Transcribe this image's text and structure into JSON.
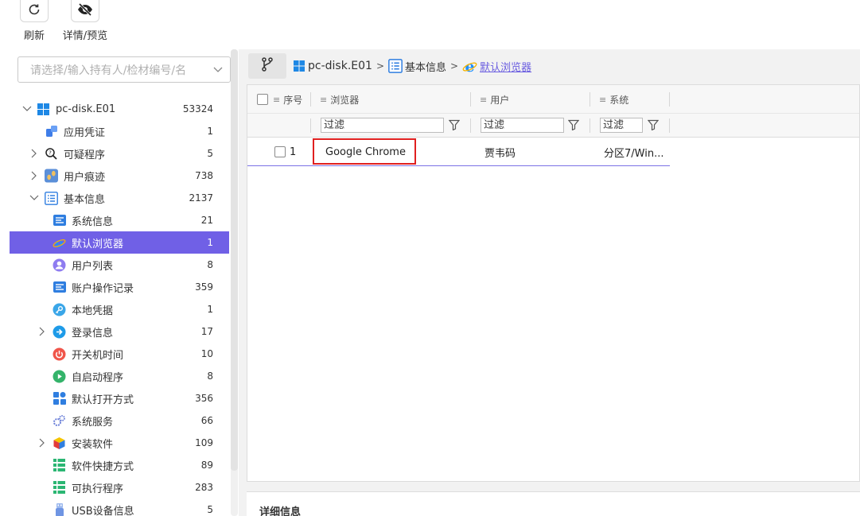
{
  "toolbar": {
    "refresh_label": "刷新",
    "detail_label": "详情/预览"
  },
  "search": {
    "placeholder": "请选择/输入持有人/检材编号/名"
  },
  "tree": {
    "root": {
      "label": "pc-disk.E01",
      "count": "53324",
      "icon": "windows-icon"
    },
    "items": [
      {
        "label": "应用凭证",
        "count": "1",
        "icon": "app-credential-icon"
      },
      {
        "label": "可疑程序",
        "count": "5",
        "icon": "suspicious-program-icon"
      },
      {
        "label": "用户痕迹",
        "count": "738",
        "icon": "user-trace-icon"
      },
      {
        "label": "基本信息",
        "count": "2137",
        "icon": "basic-info-icon"
      },
      {
        "label": "系统信息",
        "count": "21",
        "icon": "system-info-icon"
      },
      {
        "label": "默认浏览器",
        "count": "1",
        "icon": "ie-browser-icon"
      },
      {
        "label": "用户列表",
        "count": "8",
        "icon": "user-list-icon"
      },
      {
        "label": "账户操作记录",
        "count": "359",
        "icon": "account-log-icon"
      },
      {
        "label": "本地凭据",
        "count": "1",
        "icon": "key-icon"
      },
      {
        "label": "登录信息",
        "count": "17",
        "icon": "login-icon"
      },
      {
        "label": "开关机时间",
        "count": "10",
        "icon": "power-icon"
      },
      {
        "label": "自启动程序",
        "count": "8",
        "icon": "play-icon"
      },
      {
        "label": "默认打开方式",
        "count": "356",
        "icon": "tiles-icon"
      },
      {
        "label": "系统服务",
        "count": "66",
        "icon": "gears-icon"
      },
      {
        "label": "安装软件",
        "count": "109",
        "icon": "package-icon"
      },
      {
        "label": "软件快捷方式",
        "count": "89",
        "icon": "list-icon"
      },
      {
        "label": "可执行程序",
        "count": "283",
        "icon": "list-icon"
      },
      {
        "label": "USB设备信息",
        "count": "5",
        "icon": "usb-icon"
      }
    ]
  },
  "breadcrumb": {
    "items": [
      "pc-disk.E01",
      "基本信息",
      "默认浏览器"
    ]
  },
  "grid": {
    "columns": [
      "序号",
      "浏览器",
      "用户",
      "系统"
    ],
    "filter_placeholder": "过滤",
    "rows": [
      {
        "index": "1",
        "browser": "Google Chrome",
        "user": "贾韦码",
        "system": "分区7/Win..."
      }
    ]
  },
  "detail": {
    "title": "详细信息"
  },
  "colors": {
    "accent": "#7060e6",
    "highlight": "#e02020"
  }
}
